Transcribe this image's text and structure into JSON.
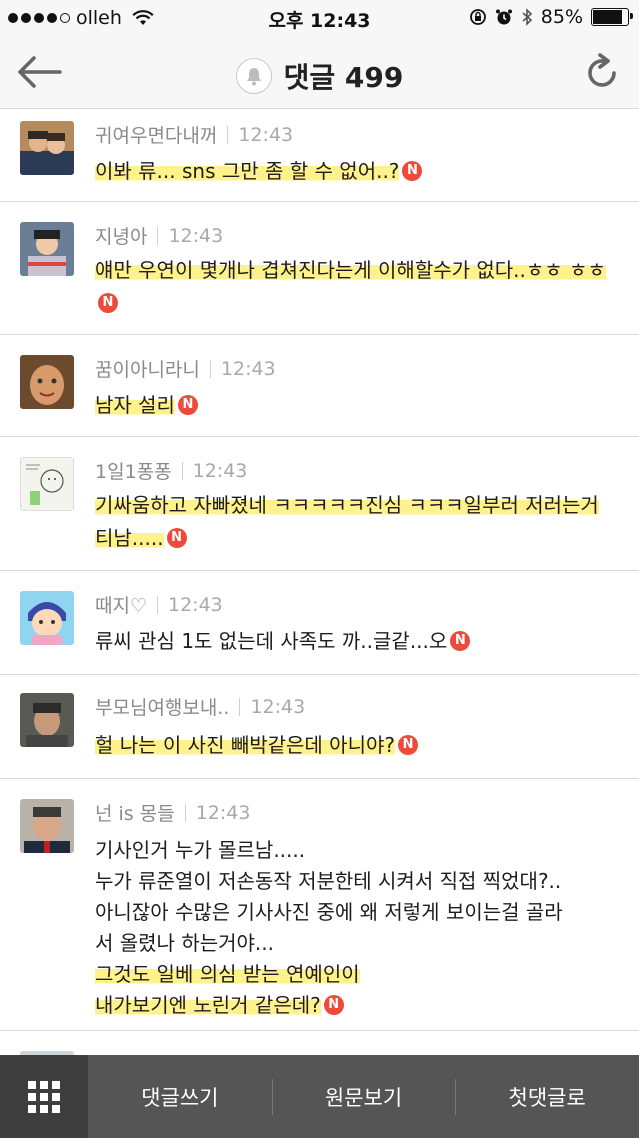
{
  "status_bar": {
    "carrier": "olleh",
    "time": "오후 12:43",
    "battery": "85%",
    "battery_level": 0.85,
    "icons": [
      "signal-dots",
      "wifi-icon",
      "lock-rotation-icon",
      "alarm-icon",
      "bluetooth-icon",
      "battery-icon"
    ]
  },
  "header": {
    "title": "댓글 499",
    "back_icon": "arrow-left-icon",
    "bell_icon": "bell-icon",
    "refresh_icon": "refresh-icon"
  },
  "comments": [
    {
      "user": "귀여우면다내꺼",
      "time": "12:43",
      "text": "이봐 류... sns 그만 좀 할 수 없어..?",
      "badge": "N"
    },
    {
      "user": "지녕아",
      "time": "12:43",
      "text": "얘만 우연이 몇개나 겹쳐진다는게 이해할수가 없다..ㅎㅎ ㅎㅎ",
      "badge": "N"
    },
    {
      "user": "꿈이아니라니",
      "time": "12:43",
      "text": "남자 설리",
      "badge": "N"
    },
    {
      "user": "1일1퐁퐁",
      "time": "12:43",
      "text": "기싸움하고 자빠졌네 ㅋㅋㅋㅋㅋ진심 ㅋㅋㅋ일부러 저러는거 티남.....",
      "badge": "N"
    },
    {
      "user": "때지♡",
      "time": "12:43",
      "text": "류씨 관심 1도 없는데 사족도 까..글같...오",
      "badge": "N"
    },
    {
      "user": "부모님여행보내..",
      "time": "12:43",
      "text": "헐 나는 이 사진 빼박같은데 아니야?",
      "badge": "N"
    },
    {
      "user": "넌 is 몽들",
      "time": "12:43",
      "lines": [
        "기사인거 누가 몰르남.....",
        "누가 류준열이 저손동작 저분한테 시켜서 직접 찍었대?..",
        "아니잖아 수많은 기사사진 중에 왜 저렇게 보이는걸 골라",
        "서 올렸나 하는거야...",
        "그것도 일베 의심 받는 연예인이",
        "내가보기엔 노린거 같은데?"
      ],
      "badge": "N"
    }
  ],
  "toolbar": {
    "grid_icon": "grid-icon",
    "write": "댓글쓰기",
    "original": "원문보기",
    "first": "첫댓글로"
  }
}
